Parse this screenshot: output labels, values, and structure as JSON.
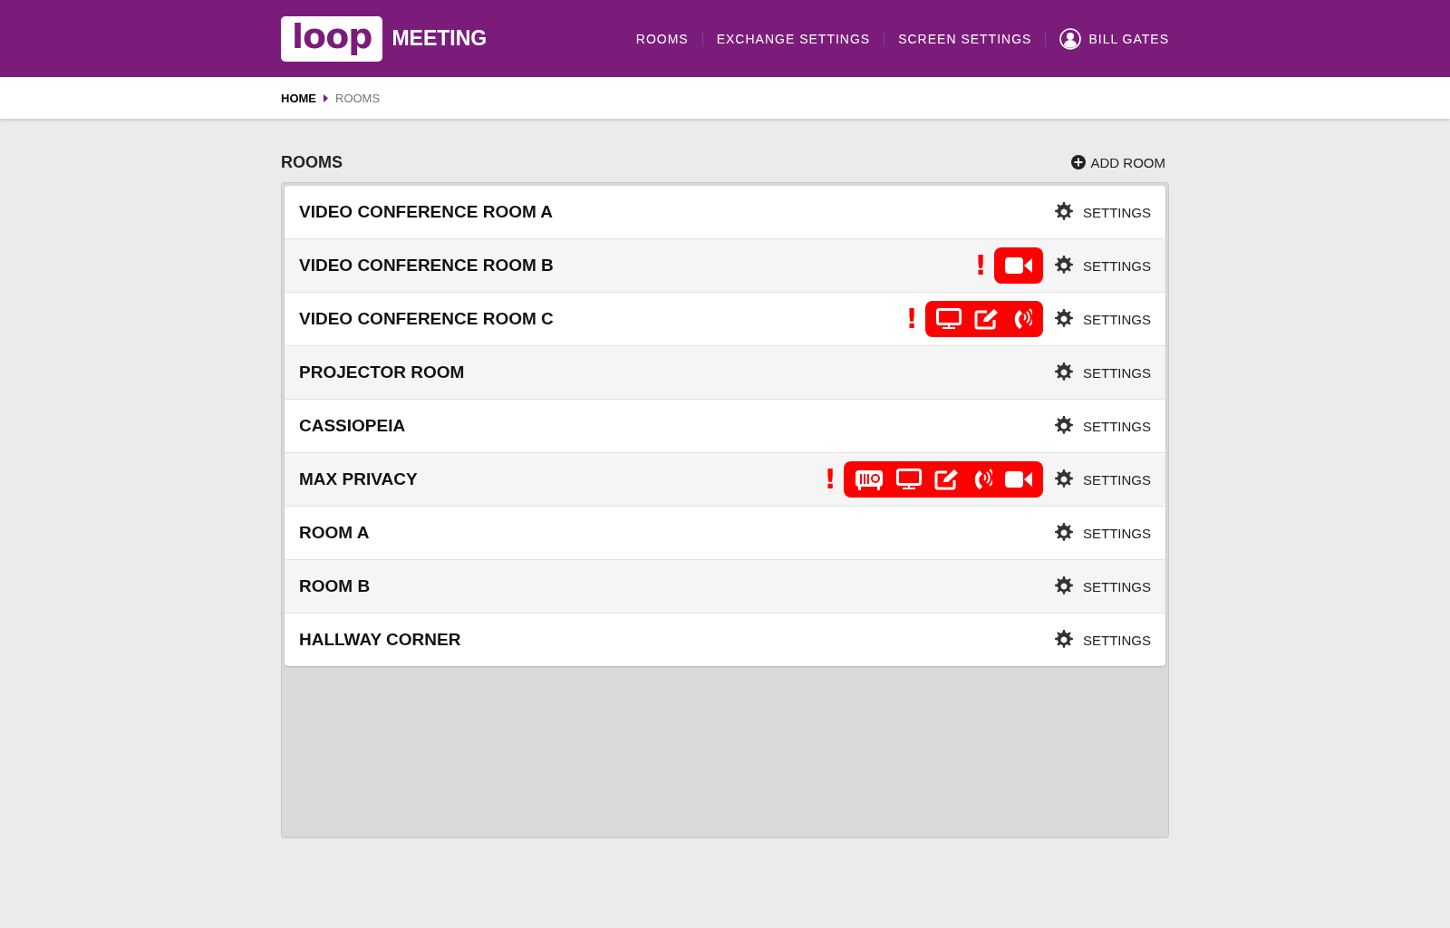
{
  "header": {
    "logo": {
      "wordmark": "loop",
      "product": "MEETING"
    },
    "nav": [
      {
        "label": "ROOMS"
      },
      {
        "label": "EXCHANGE SETTINGS"
      },
      {
        "label": "SCREEN SETTINGS"
      }
    ],
    "user": {
      "name": "BILL GATES"
    }
  },
  "breadcrumb": [
    {
      "label": "HOME",
      "selected": false
    },
    {
      "label": "ROOMS",
      "selected": true
    }
  ],
  "page": {
    "title": "ROOMS",
    "add_button": "ADD ROOM"
  },
  "rooms": [
    {
      "name": "VIDEO CONFERENCE ROOM A",
      "settings": "SETTINGS"
    },
    {
      "name": "VIDEO CONFERENCE ROOM B",
      "alert": "!",
      "issues": [
        {
          "kind": "camera"
        }
      ],
      "settings": "SETTINGS"
    },
    {
      "name": "VIDEO CONFERENCE ROOM C",
      "alert": "!",
      "issues": [
        {
          "kind": "display"
        },
        {
          "kind": "whiteboard"
        },
        {
          "kind": "phone"
        }
      ],
      "settings": "SETTINGS"
    },
    {
      "name": "PROJECTOR ROOM",
      "settings": "SETTINGS"
    },
    {
      "name": "CASSIOPEIA",
      "settings": "SETTINGS"
    },
    {
      "name": "MAX PRIVACY",
      "alert": "!",
      "issues": [
        {
          "kind": "projector"
        },
        {
          "kind": "display"
        },
        {
          "kind": "whiteboard"
        },
        {
          "kind": "phone"
        },
        {
          "kind": "camera"
        }
      ],
      "settings": "SETTINGS"
    },
    {
      "name": "ROOM A",
      "settings": "SETTINGS"
    },
    {
      "name": "ROOM B",
      "settings": "SETTINGS"
    },
    {
      "name": "HALLWAY CORNER",
      "settings": "SETTINGS"
    }
  ]
}
